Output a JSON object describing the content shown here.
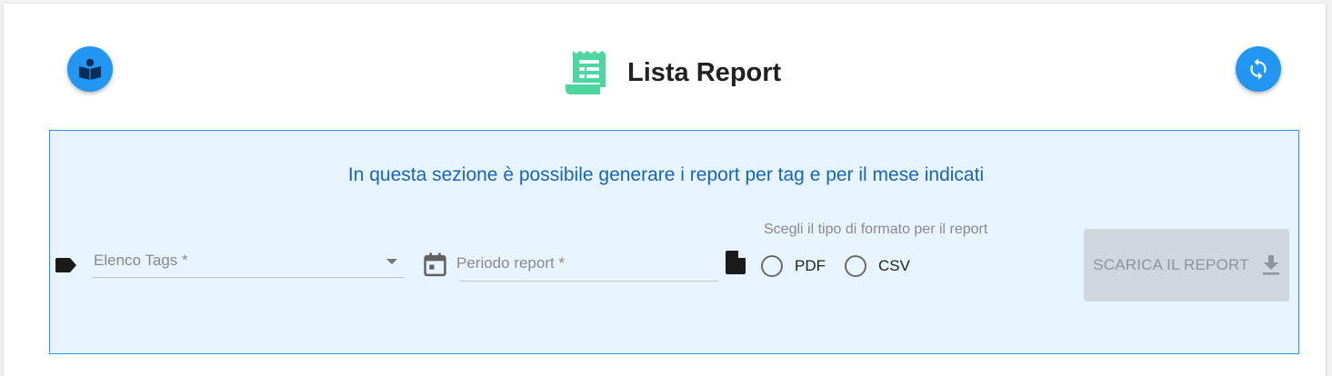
{
  "header": {
    "title": "Lista Report",
    "guide_button_icon": "book-reader-icon",
    "refresh_button_icon": "sync-icon",
    "title_icon": "receipt-icon"
  },
  "panel": {
    "info_text": "In questa sezione è possibile generare i report per tag e per il mese indicati",
    "tags_select": {
      "label": "Elenco Tags *",
      "value": ""
    },
    "period_input": {
      "label": "Periodo report *",
      "value": ""
    },
    "format": {
      "label": "Scegli il tipo di formato per il report",
      "options": [
        {
          "label": "PDF",
          "selected": false
        },
        {
          "label": "CSV",
          "selected": false
        }
      ]
    },
    "download_button": {
      "label": "SCARICA IL REPORT",
      "disabled": true,
      "icon": "download-icon"
    }
  },
  "colors": {
    "accent": "#2196f3",
    "panel_bg": "#e8f4fd",
    "info_text": "#1565c0",
    "title_icon": "#4cd6a0",
    "disabled_button": "#ced6de"
  }
}
